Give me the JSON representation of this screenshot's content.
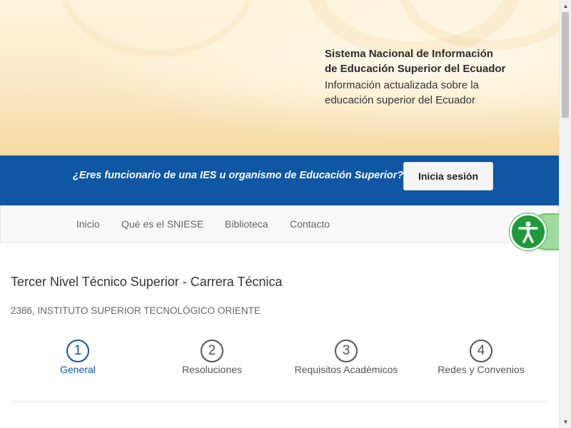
{
  "banner": {
    "title_line1": "Sistema Nacional de Información",
    "title_line2": "de Educación Superior del Ecuador",
    "subtitle_line1": "Información actualizada sobre la",
    "subtitle_line2": "educación superior del Ecuador"
  },
  "login_bar": {
    "question": "¿Eres funcionario de una IES u organismo de Educación Superior?",
    "button_label": "Inicia sesión"
  },
  "nav": {
    "items": [
      {
        "label": "Inicio"
      },
      {
        "label": "Qué es el SNIESE"
      },
      {
        "label": "Biblioteca"
      },
      {
        "label": "Contacto"
      }
    ]
  },
  "accessibility": {
    "icon": "accessibility-icon",
    "color": "#1f9a3a"
  },
  "content": {
    "program_title": "Tercer Nivel Técnico Superior - Carrera Técnica",
    "institution": "2386, INSTITUTO SUPERIOR TECNOLÓGICO ORIENTE"
  },
  "steps": [
    {
      "number": "1",
      "label": "General",
      "active": true
    },
    {
      "number": "2",
      "label": "Resoluciones",
      "active": false
    },
    {
      "number": "3",
      "label": "Requisitos Académicos",
      "active": false
    },
    {
      "number": "4",
      "label": "Redes y Convenios",
      "active": false
    }
  ],
  "colors": {
    "primary_blue": "#0f56a3",
    "accent_green": "#1f9a3a"
  }
}
